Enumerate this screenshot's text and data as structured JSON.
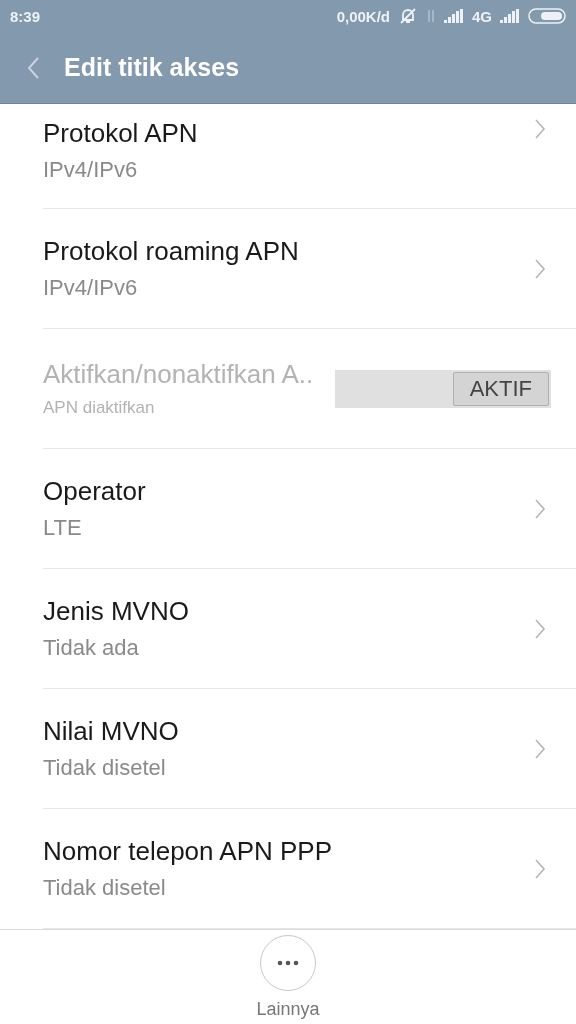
{
  "status_bar": {
    "time": "8:39",
    "speed": "0,00K/d",
    "network": "4G"
  },
  "header": {
    "title": "Edit titik akses"
  },
  "items": [
    {
      "kind": "nav",
      "title": "Protokol APN",
      "value": "IPv4/IPv6"
    },
    {
      "kind": "nav",
      "title": "Protokol roaming APN",
      "value": "IPv4/IPv6"
    },
    {
      "kind": "toggle",
      "title": "Aktifkan/nonaktifkan A..",
      "value": "APN diaktifkan",
      "disabled": true,
      "on": true,
      "toggle_label": "AKTIF"
    },
    {
      "kind": "nav",
      "title": "Operator",
      "value": "LTE"
    },
    {
      "kind": "nav",
      "title": "Jenis MVNO",
      "value": "Tidak ada"
    },
    {
      "kind": "nav",
      "title": "Nilai MVNO",
      "value": "Tidak disetel"
    },
    {
      "kind": "nav",
      "title": "Nomor telepon APN PPP",
      "value": "Tidak disetel"
    }
  ],
  "bottom": {
    "label": "Lainnya"
  }
}
